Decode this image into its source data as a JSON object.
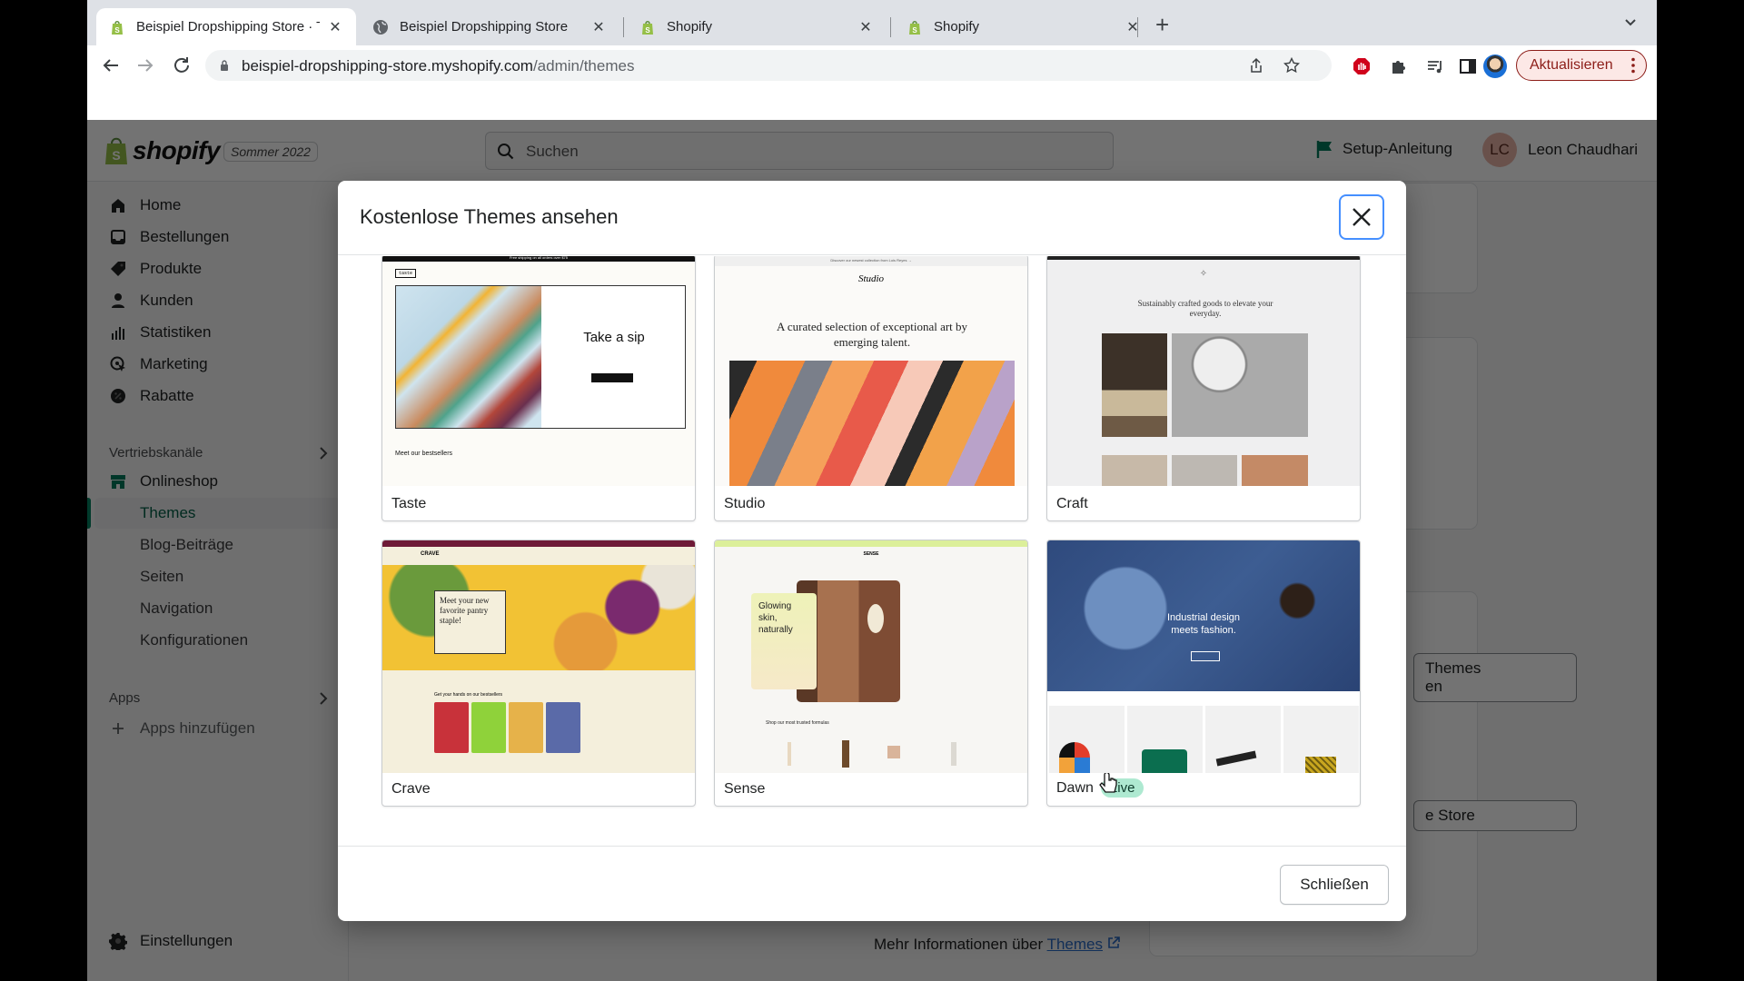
{
  "browser": {
    "tabs": [
      {
        "title": "Beispiel Dropshipping Store · Themes",
        "icon": "shopify-bag-icon",
        "active": true
      },
      {
        "title": "Beispiel Dropshipping Store",
        "icon": "globe-icon",
        "active": false
      },
      {
        "title": "Shopify",
        "icon": "shopify-bag-icon",
        "active": false
      },
      {
        "title": "Shopify",
        "icon": "shopify-bag-icon",
        "active": false
      }
    ],
    "url_host": "beispiel-dropshipping-store.myshopify.com",
    "url_path": "/admin/themes",
    "update_label": "Aktualisieren"
  },
  "admin": {
    "brand": "shopify",
    "edition": "Sommer 2022",
    "search_placeholder": "Suchen",
    "setup_label": "Setup-Anleitung",
    "user": {
      "initials": "LC",
      "name": "Leon Chaudhari"
    },
    "nav": [
      {
        "label": "Home",
        "icon": "home-icon"
      },
      {
        "label": "Bestellungen",
        "icon": "inbox-icon"
      },
      {
        "label": "Produkte",
        "icon": "tag-icon"
      },
      {
        "label": "Kunden",
        "icon": "person-icon"
      },
      {
        "label": "Statistiken",
        "icon": "bar-chart-icon"
      },
      {
        "label": "Marketing",
        "icon": "target-icon"
      },
      {
        "label": "Rabatte",
        "icon": "discount-icon"
      }
    ],
    "sales_channels_header": "Vertriebskanäle",
    "online_store": "Onlineshop",
    "online_store_sub": [
      "Themes",
      "Blog-Beiträge",
      "Seiten",
      "Navigation",
      "Konfigurationen"
    ],
    "apps_header": "Apps",
    "add_apps": "Apps hinzufügen",
    "settings": "Einstellungen",
    "bg_button_1_line1": "Themes",
    "bg_button_1_line2": "en",
    "bg_button_2": "e Store",
    "more_info_prefix": "Mehr Informationen über",
    "more_info_link": "Themes"
  },
  "modal": {
    "title": "Kostenlose Themes ansehen",
    "close_button": "Schließen",
    "themes": [
      {
        "name": "Taste",
        "live": false,
        "headline": "Take a sip",
        "section": "Meet our bestsellers",
        "logo": "taste",
        "banner": "Free shipping on all orders over $75"
      },
      {
        "name": "Studio",
        "live": false,
        "headline": "A curated selection of exceptional art by emerging talent.",
        "logo": "Studio",
        "banner": "Discover our newest collection from Lois Reyes →"
      },
      {
        "name": "Craft",
        "live": false,
        "headline": "Sustainably crafted goods to elevate your everyday."
      },
      {
        "name": "Crave",
        "live": false,
        "headline": "Meet your new favorite pantry staple!",
        "section": "Get your hands on our bestsellers",
        "logo": "CRAVE"
      },
      {
        "name": "Sense",
        "live": false,
        "headline": "Glowing skin, naturally",
        "section": "Shop our most trusted formulas",
        "logo": "SENSE"
      },
      {
        "name": "Dawn",
        "live": true,
        "live_label": "Live",
        "headline": "Industrial design meets fashion."
      }
    ]
  }
}
